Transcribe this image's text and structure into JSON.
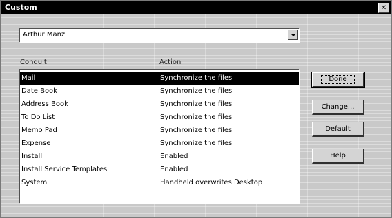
{
  "window": {
    "title": "Custom"
  },
  "user_combo": {
    "value": "Arthur Manzi"
  },
  "columns": {
    "conduit": "Conduit",
    "action": "Action"
  },
  "rows": [
    {
      "conduit": "Mail",
      "action": "Synchronize the files",
      "selected": true
    },
    {
      "conduit": "Date Book",
      "action": "Synchronize the files"
    },
    {
      "conduit": "Address Book",
      "action": "Synchronize the files"
    },
    {
      "conduit": "To Do List",
      "action": "Synchronize the files"
    },
    {
      "conduit": "Memo Pad",
      "action": "Synchronize the files"
    },
    {
      "conduit": "Expense",
      "action": "Synchronize the files"
    },
    {
      "conduit": "Install",
      "action": "Enabled"
    },
    {
      "conduit": "Install Service Templates",
      "action": "Enabled"
    },
    {
      "conduit": "System",
      "action": "Handheld overwrites Desktop"
    }
  ],
  "buttons": {
    "done": "Done",
    "change": "Change...",
    "default": "Default",
    "help": "Help"
  },
  "colors": {
    "titlebar": "#000000",
    "selection": "#000000",
    "face": "#c9c9c9"
  },
  "icons": {
    "close": "close-icon",
    "dropdown": "chevron-down-icon"
  }
}
